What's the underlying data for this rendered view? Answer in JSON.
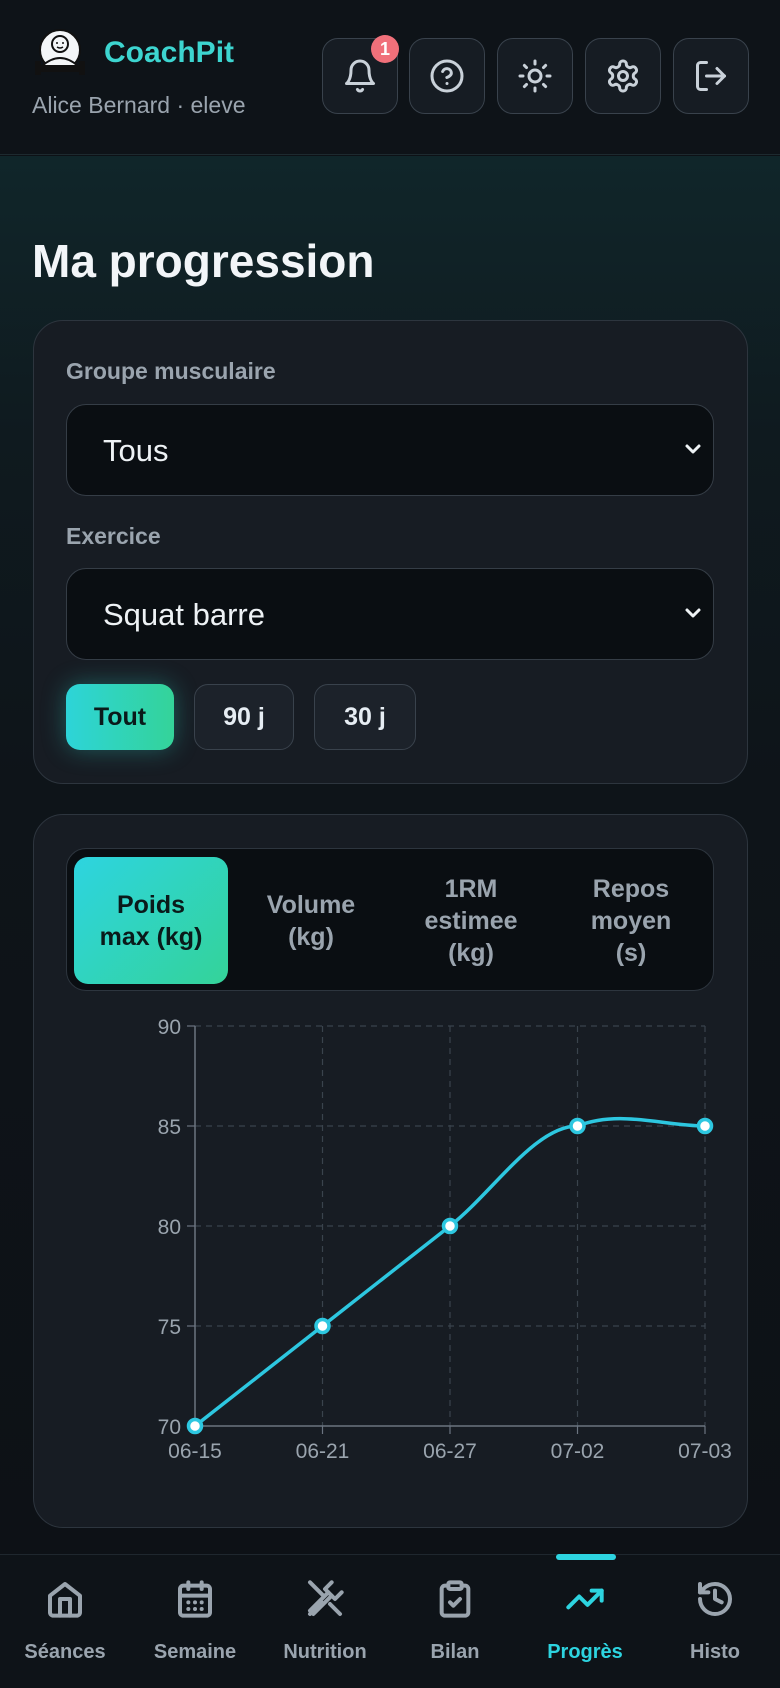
{
  "app": {
    "brand": "CoachPit",
    "user_line": "Alice Bernard · eleve",
    "notification_count": "1"
  },
  "page": {
    "title": "Ma progression"
  },
  "filters": {
    "muscle_group_label": "Groupe musculaire",
    "muscle_group_value": "Tous",
    "exercise_label": "Exercice",
    "exercise_value": "Squat barre",
    "periods": [
      "Tout",
      "90 j",
      "30 j"
    ],
    "active_period": "Tout"
  },
  "metric_tabs": [
    "Poids\nmax (kg)",
    "Volume\n(kg)",
    "1RM\nestimee\n(kg)",
    "Repos\nmoyen\n(s)"
  ],
  "chart_data": {
    "type": "line",
    "x": [
      "06-15",
      "06-21",
      "06-27",
      "07-02",
      "07-03"
    ],
    "series": [
      {
        "values": [
          70,
          75,
          80,
          85,
          85
        ]
      }
    ],
    "ylim": [
      70,
      90
    ],
    "yticks": [
      70,
      75,
      80,
      85,
      90
    ],
    "grid": true,
    "color": "#2dc7e0"
  },
  "nav": {
    "items": [
      {
        "label": "Séances",
        "icon": "home-icon"
      },
      {
        "label": "Semaine",
        "icon": "calendar-icon"
      },
      {
        "label": "Nutrition",
        "icon": "utensils-icon"
      },
      {
        "label": "Bilan",
        "icon": "clipboard-check-icon"
      },
      {
        "label": "Progrès",
        "icon": "trending-up-icon"
      },
      {
        "label": "Histo",
        "icon": "history-icon"
      }
    ],
    "active": "Progrès"
  },
  "colors": {
    "accent": "#2dd4e0",
    "accent2": "#34d399",
    "brand": "#3dd5d0",
    "badge": "#f0707a",
    "background": "#0d1116",
    "card": "#171c23"
  }
}
